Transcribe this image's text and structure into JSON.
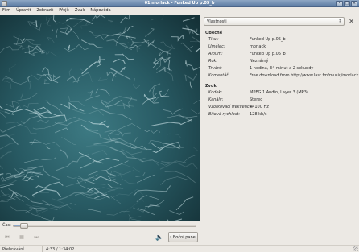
{
  "window": {
    "title": "01 morlack - Funked Up p.05_b"
  },
  "menu": [
    "Film",
    "Úpravit",
    "Zobrazit",
    "Přejít",
    "Zvuk",
    "Nápověda"
  ],
  "seek": {
    "label": "Čas:",
    "progress": 0.047
  },
  "controls": {
    "side_panel_label": "Boční panel"
  },
  "side": {
    "dropdown_value": "Vlastnosti",
    "general": {
      "title": "Obecné",
      "rows": [
        {
          "k": "Titul:",
          "v": "Funked Up p.05_b"
        },
        {
          "k": "Umělec:",
          "v": "morlack"
        },
        {
          "k": "Album:",
          "v": "Funked Up p.05_b"
        },
        {
          "k": "Rok:",
          "v": "Neznámý"
        },
        {
          "k": "Trvání:",
          "v": "1 hodina, 34 minut a 2 sekundy"
        },
        {
          "k": "Komentář:",
          "v": "Free download from http://www.last.fm/music/morlack"
        }
      ]
    },
    "audio": {
      "title": "Zvuk",
      "rows": [
        {
          "k": "Kodek:",
          "v": "MPEG 1 Audio, Layer 3 (MP3)"
        },
        {
          "k": "Kanály:",
          "v": "Stereo"
        },
        {
          "k": "Vzorkovací frekvence:",
          "v": "44100 Hz"
        },
        {
          "k": "Bitová rychlost:",
          "v": "128 kb/s"
        }
      ]
    }
  },
  "status": {
    "state": "Přehrávání",
    "time": "4:33 / 1:34:02"
  },
  "icons": {
    "prev": "skip-back-icon",
    "play": "play-pause-icon",
    "next": "skip-forward-icon",
    "volume": "volume-icon",
    "close": "close-icon",
    "arrow": "chevron-down-icon"
  },
  "colors": {
    "video_base": "#1e3f47",
    "seek_fill": "#8ba5c7"
  }
}
